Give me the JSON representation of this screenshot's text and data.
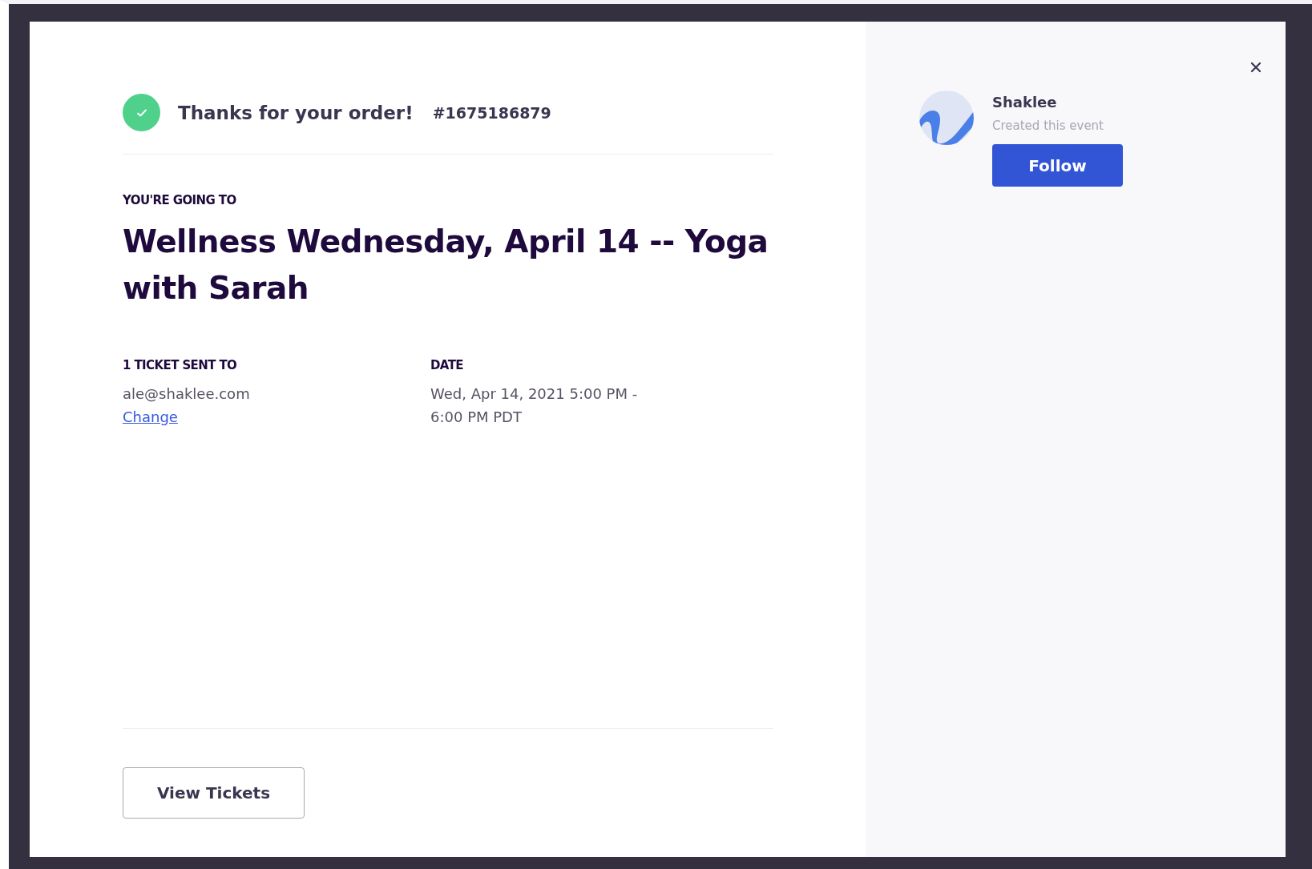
{
  "order": {
    "confirmed": true,
    "message": "Thanks for your order!",
    "number": "#1675186879"
  },
  "event": {
    "label": "YOU'RE GOING TO",
    "title": "Wellness Wednesday, April 14 -- Yoga with Sarah"
  },
  "details": [
    {
      "heading": "1 TICKET SENT TO",
      "lines": [
        "ale@shaklee.com"
      ],
      "link": "Change"
    },
    {
      "heading": "DATE",
      "lines": [
        "Wed, Apr 14, 2021 5:00 PM -",
        "6:00 PM PDT"
      ]
    }
  ],
  "actions": {
    "view_tickets": "View Tickets"
  },
  "organizer": {
    "name": "Shaklee",
    "subtitle": "Created this event",
    "follow": "Follow"
  }
}
